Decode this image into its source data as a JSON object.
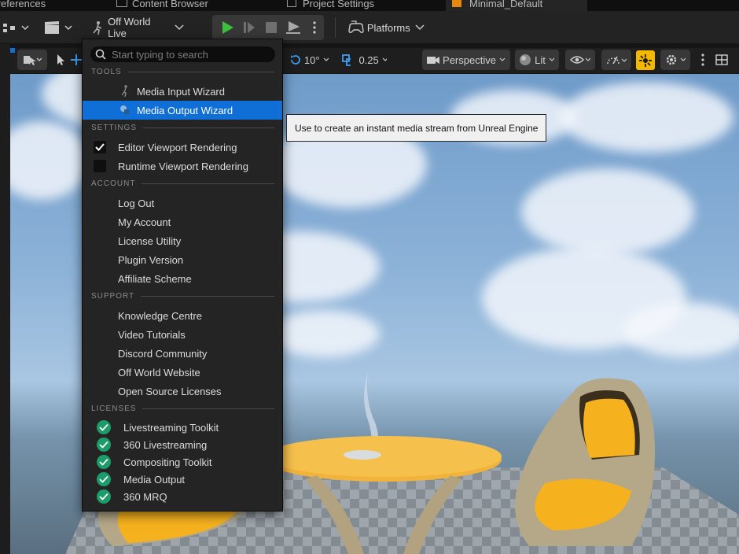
{
  "tabs": [
    {
      "label": "Preferences"
    },
    {
      "label": "Content Browser"
    },
    {
      "label": "Project Settings"
    },
    {
      "label": "Minimal_Default"
    }
  ],
  "toolbar": {
    "plugin_label": "Off World Live",
    "platforms_label": "Platforms"
  },
  "viewport_bar": {
    "rotation_snap": "10°",
    "scale_snap": "0.25",
    "view_mode": "Perspective",
    "lighting_mode": "Lit"
  },
  "menu": {
    "search_placeholder": "Start typing to search",
    "sections": {
      "tools": "TOOLS",
      "settings": "SETTINGS",
      "account": "ACCOUNT",
      "support": "SUPPORT",
      "licenses": "LICENSES"
    },
    "tools": [
      {
        "label": "Media Input Wizard",
        "icon": "wizard-figure-icon"
      },
      {
        "label": "Media Output Wizard",
        "icon": "media-output-icon"
      }
    ],
    "settings": [
      {
        "label": "Editor Viewport Rendering",
        "checked": true
      },
      {
        "label": "Runtime Viewport Rendering",
        "checked": false
      }
    ],
    "account": [
      {
        "label": "Log Out"
      },
      {
        "label": "My Account"
      },
      {
        "label": "License Utility"
      },
      {
        "label": "Plugin Version"
      },
      {
        "label": "Affiliate Scheme"
      }
    ],
    "support": [
      {
        "label": "Knowledge Centre"
      },
      {
        "label": "Video Tutorials"
      },
      {
        "label": "Discord Community"
      },
      {
        "label": "Off World Website"
      },
      {
        "label": "Open Source Licenses"
      }
    ],
    "licenses": [
      {
        "label": "Livestreaming Toolkit",
        "status": "active"
      },
      {
        "label": "360 Livestreaming",
        "status": "active"
      },
      {
        "label": "Compositing Toolkit",
        "status": "active"
      },
      {
        "label": "Media Output",
        "status": "active"
      },
      {
        "label": "360 MRQ",
        "status": "active"
      }
    ]
  },
  "tooltip": {
    "text": "Use to create an instant media stream from Unreal Engine"
  },
  "colors": {
    "highlight": "#0f6fd6",
    "play_green": "#3fbf3f",
    "license_green": "#1c9c6a",
    "camera_speed_yellow": "#f5b800",
    "tab_accent_orange": "#e8890c"
  }
}
